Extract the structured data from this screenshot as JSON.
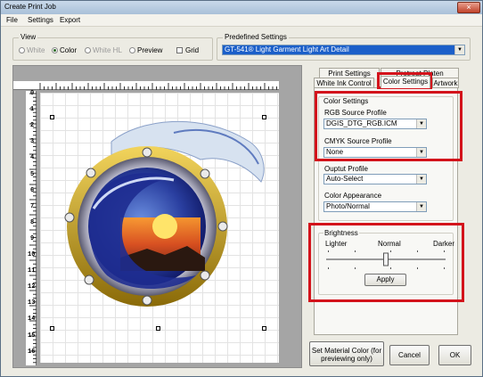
{
  "window": {
    "title": "Create Print Job",
    "close_glyph": "×"
  },
  "menu": [
    "File",
    "Settings",
    "Export"
  ],
  "view": {
    "label": "View",
    "options": [
      {
        "label": "White",
        "selected": false,
        "enabled": false
      },
      {
        "label": "Color",
        "selected": true,
        "enabled": true
      },
      {
        "label": "White HL",
        "selected": false,
        "enabled": false
      },
      {
        "label": "Preview",
        "selected": false,
        "enabled": true
      }
    ],
    "grid_label": "Grid",
    "grid_checked": false
  },
  "predefined": {
    "label": "Predefined Settings",
    "value": "GT-541® Light Garment Light Art Detail"
  },
  "ruler": {
    "top": [
      "0",
      "1",
      "2",
      "3",
      "4",
      "5",
      "6",
      "7",
      "8",
      "9",
      "10",
      "11",
      "12",
      "13",
      "14"
    ],
    "left": [
      "0",
      "1",
      "2",
      "3",
      "4",
      "5",
      "6",
      "7",
      "8",
      "9",
      "10",
      "11",
      "12",
      "13",
      "14",
      "15",
      "16"
    ]
  },
  "tabs": {
    "row_back": [
      "Print Settings",
      "Pretreat Platen"
    ],
    "row_front": [
      "White Ink Control",
      "Color Settings",
      "Artwork"
    ],
    "active": "Color Settings"
  },
  "color_settings": {
    "group_label": "Color Settings",
    "rgb_label": "RGB Source Profile",
    "rgb_value": "DGIS_DTG_RGB.ICM",
    "cmyk_label": "CMYK Source Profile",
    "cmyk_value": "None",
    "output_label": "Ouptut Profile",
    "output_value": "Auto-Select",
    "appearance_label": "Color Appearance",
    "appearance_value": "Photo/Normal"
  },
  "brightness": {
    "group_label": "Brightness",
    "lighter": "Lighter",
    "normal": "Normal",
    "darker": "Darker",
    "level": 0.5,
    "apply": "Apply"
  },
  "buttons": {
    "material": "Set Material Color (for previewing only)",
    "cancel": "Cancel",
    "ok": "OK"
  },
  "colors": {
    "accent": "#1b5fc9",
    "highlight": "#d3131b"
  }
}
